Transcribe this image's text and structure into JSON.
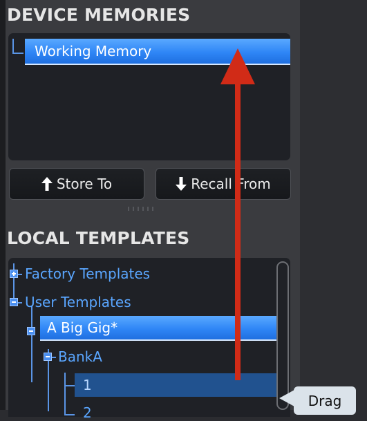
{
  "device_memories": {
    "title": "DEVICE MEMORIES",
    "items": [
      {
        "label": "Working Memory",
        "selected": true
      }
    ]
  },
  "buttons": {
    "store_label": "Store To",
    "recall_label": "Recall From",
    "store_icon": "arrow-up-icon",
    "recall_icon": "arrow-down-icon"
  },
  "local_templates": {
    "title": "LOCAL TEMPLATES",
    "tree": [
      {
        "label": "Factory Templates",
        "expanded": false
      },
      {
        "label": "User Templates",
        "expanded": true
      },
      {
        "label": "A Big Gig*",
        "selected": true
      },
      {
        "label": "BankA",
        "expanded": true
      },
      {
        "label": "1",
        "highlighted": true
      },
      {
        "label": "2"
      }
    ]
  },
  "tooltip": {
    "text": "Drag"
  },
  "colors": {
    "accent_blue": "#2f86f6",
    "arrow_red": "#d12b17"
  }
}
